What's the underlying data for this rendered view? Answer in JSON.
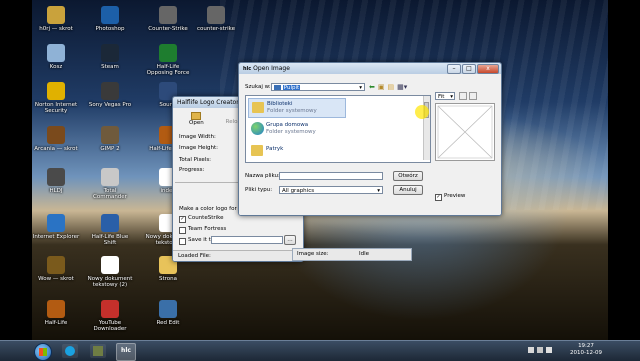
{
  "desktop": {
    "icons": [
      {
        "label": "h0rj — skrot",
        "icon": "folder-shortcut-icon",
        "color": "#c9a23c"
      },
      {
        "label": "Photoshop",
        "icon": "photoshop-icon",
        "color": "#1c5fa8"
      },
      {
        "label": "Counter-Strike",
        "icon": "counter-strike-icon",
        "color": "#666666"
      },
      {
        "label": "counter-strike",
        "icon": "counter-strike-icon",
        "color": "#666666"
      },
      {
        "label": "Kosz",
        "icon": "recycle-bin-icon",
        "color": "#8fb2d6"
      },
      {
        "label": "Steam",
        "icon": "steam-icon",
        "color": "#1b2838"
      },
      {
        "label": "Half-Life Opposing Force",
        "icon": "half-life-of-icon",
        "color": "#1e7d2f"
      },
      {
        "label": "Norton Internet Security",
        "icon": "norton-icon",
        "color": "#e0b100"
      },
      {
        "label": "Sony Vegas Pro",
        "icon": "vegas-icon",
        "color": "#3a3a3a"
      },
      {
        "label": "Sound",
        "icon": "sound-icon",
        "color": "#2d4a7a"
      },
      {
        "label": "Arcania — skrot",
        "icon": "arcania-icon",
        "color": "#7a4a1c"
      },
      {
        "label": "GIMP 2",
        "icon": "gimp-icon",
        "color": "#6f5a3c"
      },
      {
        "label": "Half-Life Logo",
        "icon": "half-life-icon",
        "color": "#b25b12"
      },
      {
        "label": "HLDJ",
        "icon": "hldj-icon",
        "color": "#4a4a4a"
      },
      {
        "label": "Total Commander",
        "icon": "total-commander-icon",
        "color": "#c8c8c8"
      },
      {
        "label": "index",
        "icon": "document-icon",
        "color": "#ffffff"
      },
      {
        "label": "Internet Explorer",
        "icon": "internet-explorer-icon",
        "color": "#2a73c4"
      },
      {
        "label": "Half-Life Blue Shift",
        "icon": "half-life-bs-icon",
        "color": "#2a5fa8"
      },
      {
        "label": "Nowy dokument tekstowy",
        "icon": "text-document-icon",
        "color": "#ffffff"
      },
      {
        "label": "Wow — skrot",
        "icon": "wow-icon",
        "color": "#7a5a1c"
      },
      {
        "label": "Nowy dokument tekstowy (2)",
        "icon": "text-document-icon",
        "color": "#ffffff"
      },
      {
        "label": "Strona",
        "icon": "folder-icon",
        "color": "#e8c35a"
      },
      {
        "label": "Half-Life",
        "icon": "half-life-icon",
        "color": "#b25b12"
      },
      {
        "label": "YouTube Downloader",
        "icon": "youtube-icon",
        "color": "#c4302b"
      },
      {
        "label": "Red Edit",
        "icon": "red-edit-icon",
        "color": "#3a6fa8"
      }
    ]
  },
  "logo_window": {
    "title": "Halflife Logo Creator ver.",
    "open_label": "Open",
    "reload_label": "Reload ima",
    "image_width_label": "Image Width:",
    "image_height_label": "Image Height:",
    "total_pixels_label": "Total Pixels:",
    "progress_label": "Progress:",
    "make_color_label": "Make a color logo for mod",
    "cstrike_label": "CounteStrike",
    "tfc_label": "Team Fortress",
    "save_label": "Save it to",
    "status_loaded": "Loaded File:",
    "status_size": "Image size:",
    "status_idle": "Idle"
  },
  "open_dialog": {
    "title": "Open Image",
    "look_in_label": "Szukaj w:",
    "look_in_value": "Pulpit",
    "places": [
      {
        "name": "Biblioteki",
        "type": "Folder systemowy"
      },
      {
        "name": "Grupa domowa",
        "type": "Folder systemowy"
      },
      {
        "name": "Patryk",
        "type": ""
      }
    ],
    "filename_label": "Nazwa pliku:",
    "filename_value": "",
    "filetype_label": "Pliki typu:",
    "filetype_value": "All graphics",
    "open_button": "Otwórz",
    "cancel_button": "Anuluj",
    "fit_value": "Fit",
    "preview_label": "Preview",
    "preview_checked": true
  },
  "taskbar": {
    "time": "19:27",
    "date": "2010-12-09"
  }
}
